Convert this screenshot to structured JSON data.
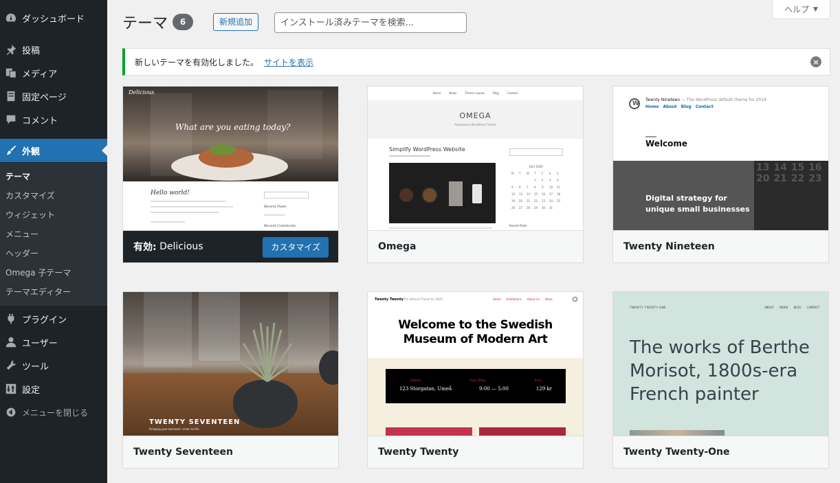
{
  "sidebar": {
    "items": [
      {
        "label": "ダッシュボード",
        "icon": "dashboard-icon"
      },
      {
        "label": "投稿",
        "icon": "pushpin-icon"
      },
      {
        "label": "メディア",
        "icon": "media-icon"
      },
      {
        "label": "固定ページ",
        "icon": "page-icon"
      },
      {
        "label": "コメント",
        "icon": "comment-icon"
      },
      {
        "label": "外観",
        "icon": "paintbrush-icon"
      },
      {
        "label": "プラグイン",
        "icon": "plugin-icon"
      },
      {
        "label": "ユーザー",
        "icon": "user-icon"
      },
      {
        "label": "ツール",
        "icon": "wrench-icon"
      },
      {
        "label": "設定",
        "icon": "settings-icon"
      }
    ],
    "submenu": [
      "テーマ",
      "カスタマイズ",
      "ウィジェット",
      "メニュー",
      "ヘッダー",
      "Omega 子テーマ",
      "テーマエディター"
    ],
    "collapse_label": "メニューを閉じる"
  },
  "header": {
    "title": "テーマ",
    "count": "6",
    "add_new_label": "新規追加",
    "search_placeholder": "インストール済みテーマを検索...",
    "help_label": "ヘルプ"
  },
  "notice": {
    "message": "新しいテーマを有効化しました。",
    "link_text": "サイトを表示"
  },
  "themes": [
    {
      "name": "Delicious",
      "active_prefix": "有効:",
      "customize_label": "カスタマイズ"
    },
    {
      "name": "Omega"
    },
    {
      "name": "Twenty Nineteen"
    },
    {
      "name": "Twenty Seventeen"
    },
    {
      "name": "Twenty Twenty"
    },
    {
      "name": "Twenty Twenty-One"
    }
  ],
  "screenshots": {
    "delicious": {
      "logo": "Delicious",
      "tagline": "What are you eating today?",
      "post_title": "Hello world!",
      "widget1": "Recent Posts",
      "widget2": "Recent Comments"
    },
    "omega": {
      "nav": [
        "Home",
        "News",
        "Theme Layout",
        "Blog",
        "Contact"
      ],
      "title": "OMEGA",
      "subtitle": "Responsive WordPress Theme",
      "post_title": "Simplify WordPress Website",
      "calendar_title": "JULY 2020",
      "calendar_days": [
        "M",
        "T",
        "W",
        "T",
        "F",
        "S",
        "S"
      ],
      "recent_posts": "Recent Posts"
    },
    "nineteen": {
      "site_title": "Twenty Nineteen",
      "tagline": "— The WordPress default theme for 2019",
      "nav": [
        "Home",
        "About",
        "Blog",
        "Contact"
      ],
      "welcome": "Welcome",
      "hero_line1": "Digital strategy for",
      "hero_line2": "unique small businesses",
      "grid_numbers": [
        "13",
        "14",
        "15",
        "16",
        "20",
        "21",
        "22",
        "23"
      ]
    },
    "seventeen": {
      "title": "TWENTY SEVENTEEN",
      "tagline": "Bringing your business' vision to life"
    },
    "twenty": {
      "site_title": "Twenty Twenty",
      "tagline": "The Default Theme for 2020",
      "nav": [
        "Home",
        "Exhibitions",
        "About Us",
        "News"
      ],
      "heading_line1": "Welcome to the Swedish",
      "heading_line2": "Museum of Modern Art",
      "info_labels": [
        "Address",
        "Open Today",
        "Price"
      ],
      "info_values": [
        "123 Storgatan, Umeå",
        "9:00 — 5:00",
        "129 kr"
      ]
    },
    "twentyone": {
      "site_title": "TWENTY TWENTY-ONE",
      "nav": [
        "ABOUT",
        "WORK",
        "BLOG",
        "CONTACT"
      ],
      "heading_line1": "The works of Berthe",
      "heading_line2": "Morisot, 1800s-era",
      "heading_line3": "French painter"
    }
  },
  "colors": {
    "sidebar_bg": "#1d2327",
    "accent": "#2271b1",
    "notice_success": "#00a32a"
  }
}
